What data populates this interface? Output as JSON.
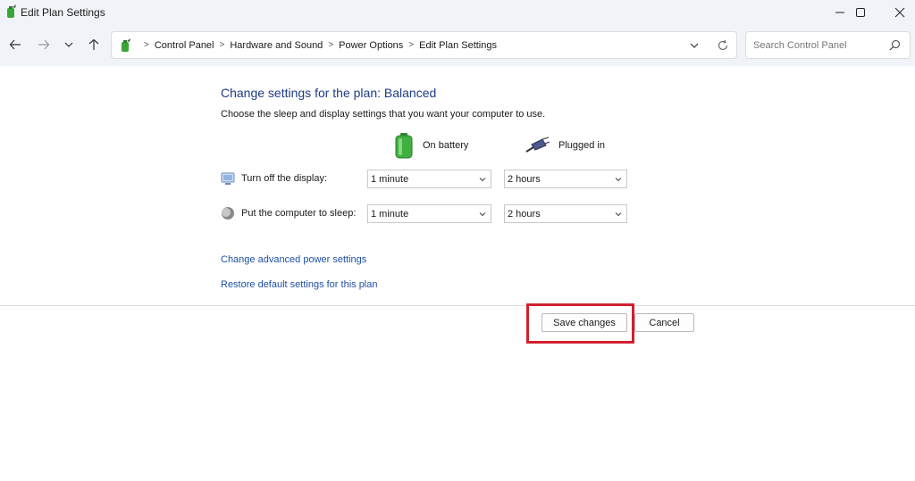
{
  "window": {
    "title": "Edit Plan Settings",
    "controls": {
      "minimize_icon": "minimize-icon",
      "maximize_icon": "maximize-icon",
      "close_icon": "close-icon"
    }
  },
  "nav": {
    "back_icon": "arrow-left-icon",
    "forward_icon": "arrow-right-icon",
    "recent_icon": "chevron-down-icon",
    "up_icon": "arrow-up-icon"
  },
  "breadcrumb": {
    "items": [
      "Control Panel",
      "Hardware and Sound",
      "Power Options",
      "Edit Plan Settings"
    ],
    "separator": ">"
  },
  "search": {
    "placeholder": "Search Control Panel"
  },
  "main": {
    "heading": "Change settings for the plan: Balanced",
    "description": "Choose the sleep and display settings that you want your computer to use.",
    "columns": {
      "battery": "On battery",
      "plugged": "Plugged in"
    },
    "rows": [
      {
        "label": "Turn off the display:",
        "battery_value": "1 minute",
        "plugged_value": "2 hours"
      },
      {
        "label": "Put the computer to sleep:",
        "battery_value": "1 minute",
        "plugged_value": "2 hours"
      }
    ],
    "links": {
      "advanced": "Change advanced power settings",
      "restore": "Restore default settings for this plan"
    }
  },
  "buttons": {
    "save": "Save changes",
    "cancel": "Cancel"
  },
  "colors": {
    "heading": "#1e3b87",
    "link": "#1e4fa8",
    "highlight": "#d0202f",
    "chrome": "#f0f4f9"
  }
}
